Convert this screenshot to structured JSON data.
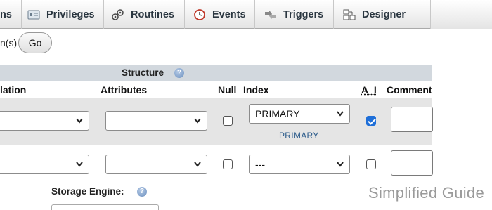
{
  "tabs": [
    {
      "label": "ns",
      "icon": "none"
    },
    {
      "label": "Privileges",
      "icon": "privileges-icon"
    },
    {
      "label": "Routines",
      "icon": "routines-icon"
    },
    {
      "label": "Events",
      "icon": "events-icon"
    },
    {
      "label": "Triggers",
      "icon": "triggers-icon"
    },
    {
      "label": "Designer",
      "icon": "designer-icon"
    }
  ],
  "go_row": {
    "prefix": "n(s)",
    "button": "Go"
  },
  "structure": {
    "title": "Structure"
  },
  "columns": {
    "collation": "lation",
    "attributes": "Attributes",
    "null": "Null",
    "index": "Index",
    "ai": "A_I",
    "comments": "Comments"
  },
  "rows": [
    {
      "collation": "",
      "attributes": "",
      "null_checked": false,
      "index": "PRIMARY",
      "index_name": "PRIMARY",
      "ai_checked": true,
      "comment": ""
    },
    {
      "collation": "",
      "attributes": "",
      "null_checked": false,
      "index": "---",
      "index_name": "",
      "ai_checked": false,
      "comment": ""
    }
  ],
  "storage_engine": {
    "label": "Storage Engine:"
  },
  "watermark": "Simplified Guide",
  "colors": {
    "structure_bar": "#d2d8de",
    "row_shaded": "#e5e5e5",
    "checkbox_on": "#1f6fd8"
  }
}
